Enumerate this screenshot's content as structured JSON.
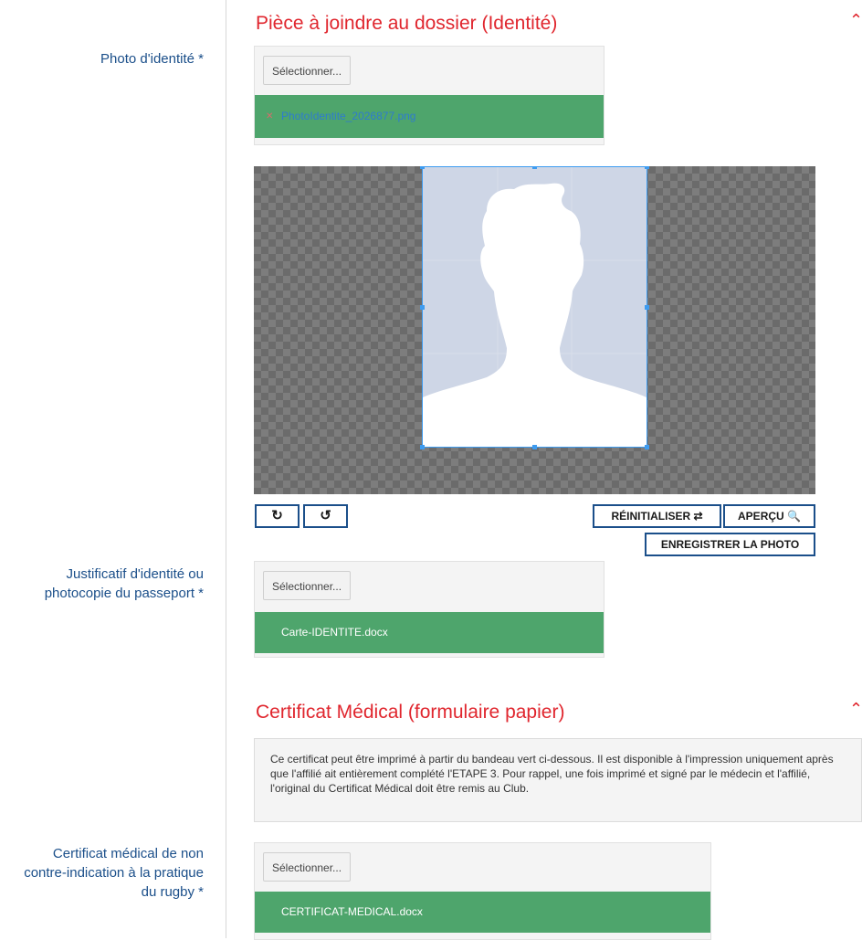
{
  "section_identity": {
    "title": "Pièce à joindre au dossier (Identité)",
    "photo_field": {
      "label": "Photo d'identité *",
      "select_label": "Sélectionner...",
      "file_name": "PhotoIdentite_2026877.png"
    },
    "cropper": {
      "rotate_right_glyph": "↻",
      "rotate_left_glyph": "↺",
      "reset_label": "RÉINITIALISER ⇄",
      "preview_label": "APERÇU 🔍",
      "save_label": "ENREGISTRER LA PHOTO"
    },
    "id_field": {
      "label_line1": "Justificatif d'identité ou",
      "label_line2": "photocopie du passeport *",
      "select_label": "Sélectionner...",
      "file_name": "Carte-IDENTITE.docx"
    }
  },
  "section_medical": {
    "title": "Certificat Médical (formulaire papier)",
    "info_line1": "Ce certificat peut être imprimé à partir du bandeau vert ci-dessous. Il est disponible à l'impression uniquement après",
    "info_line2": "que l'affilié ait entièrement complété l'ETAPE 3. Pour rappel, une fois imprimé et signé par le médecin et l'affilié,",
    "info_line3": "l'original du Certificat Médical doit être remis au Club.",
    "cert_field": {
      "label_line1": "Certificat médical de non",
      "label_line2": "contre-indication à la pratique",
      "label_line3": "du rugby *",
      "select_label": "Sélectionner...",
      "file_name": "CERTIFICAT-MEDICAL.docx"
    }
  },
  "colors": {
    "accent_red": "#e0262e",
    "label_blue": "#1b4f8a",
    "file_green": "#4ea56c",
    "crop_blue": "#3d9bf0"
  },
  "icons": [
    "rotate-right-icon",
    "rotate-left-icon",
    "reset-icon",
    "search-icon",
    "chevron-up-icon",
    "remove-file-icon"
  ]
}
